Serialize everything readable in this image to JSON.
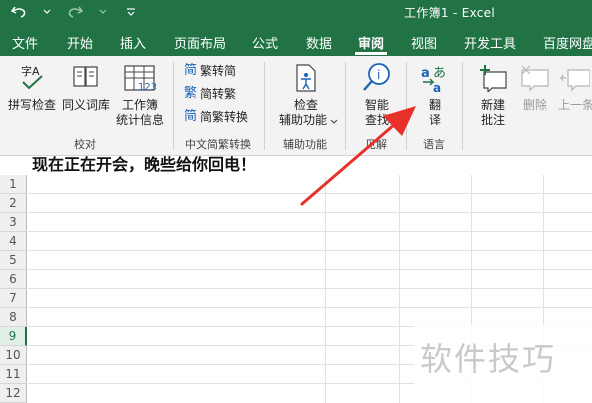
{
  "window": {
    "title": "工作簿1  -  Excel"
  },
  "tabs": [
    "文件",
    "开始",
    "插入",
    "页面布局",
    "公式",
    "数据",
    "审阅",
    "视图",
    "开发工具",
    "百度网盘"
  ],
  "active_tab": "审阅",
  "ribbon": {
    "proofing": {
      "spell_check": "拼写检查",
      "thesaurus": "同义词库",
      "workbook_stats_line1": "工作簿",
      "workbook_stats_line2": "统计信息",
      "group_label": "校对"
    },
    "chinese_conversion": {
      "trad_to_simp": "繁转简",
      "simp_to_trad": "简转繁",
      "conversion": "简繁转换",
      "group_label": "中文简繁转换"
    },
    "accessibility": {
      "check_line1": "检查",
      "check_line2": "辅助功能",
      "group_label": "辅助功能"
    },
    "insights": {
      "smart_lookup_line1": "智能",
      "smart_lookup_line2": "查找",
      "group_label": "见解"
    },
    "language": {
      "translate_line1": "翻",
      "translate_line2": "译",
      "group_label": "语言"
    },
    "comments": {
      "new_comment_line1": "新建",
      "new_comment_line2": "批注",
      "delete": "删除",
      "previous": "上一条"
    }
  },
  "strip_text": "现在正在开会，晚些给你回电！",
  "rows": [
    "1",
    "2",
    "3",
    "4",
    "5",
    "6",
    "7",
    "8",
    "9",
    "10",
    "11",
    "12"
  ],
  "selected_row": "9",
  "watermark": "软件技巧",
  "colors": {
    "excel_green": "#217346",
    "arrow_red": "#e8302a"
  }
}
